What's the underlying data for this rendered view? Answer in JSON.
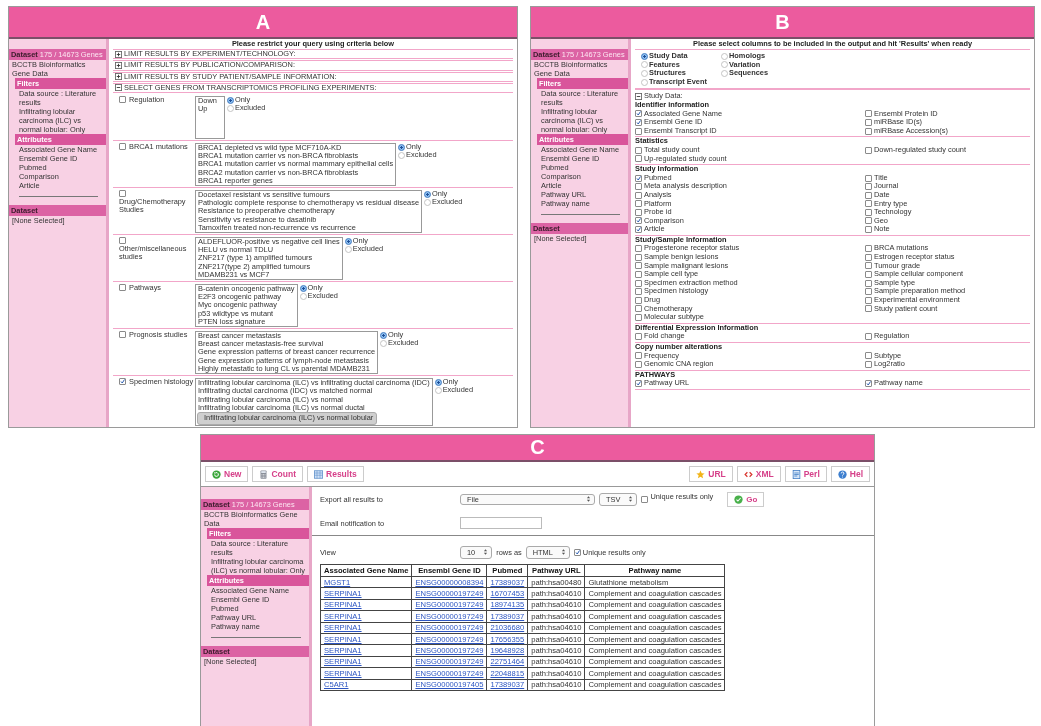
{
  "panel_a": {
    "label": "A",
    "sidebar": {
      "dataset": {
        "title": "Dataset",
        "count": "175 / 14673 Genes"
      },
      "database": "BCCTB Bioinformatics Gene Data",
      "filters": {
        "title": "Filters",
        "items": [
          "Data source : Literature results",
          "Infiltrating lobular carcinoma (ILC) vs normal lobular: Only"
        ]
      },
      "attributes": {
        "title": "Attributes",
        "items": [
          "Associated Gene Name",
          "Ensembl Gene ID",
          "Pubmed",
          "Comparison",
          "Article"
        ]
      },
      "dataset2": {
        "title": "Dataset",
        "value": "[None Selected]"
      }
    },
    "title": "Please restrict your query using criteria below",
    "sections": [
      {
        "title": "LIMIT RESULTS BY EXPERIMENT/TECHNOLOGY:",
        "expanded": false
      },
      {
        "title": "LIMIT RESULTS BY PUBLICATION/COMPARISON:",
        "expanded": false
      },
      {
        "title": "LIMIT RESULTS BY STUDY PATIENT/SAMPLE INFORMATION:",
        "expanded": false
      },
      {
        "title": "SELECT GENES FROM TRANSCRIPTOMICS PROFILING EXPERIMENTS:",
        "expanded": true
      }
    ],
    "filters": [
      {
        "label": "Regulation",
        "checked": false,
        "options": [
          {
            "text": "Down",
            "selected": false
          },
          {
            "text": "Up",
            "selected": false
          }
        ],
        "radios": [
          {
            "label": "Only",
            "selected": true
          },
          {
            "label": "Excluded",
            "selected": false
          }
        ]
      },
      {
        "label": "BRCA1 mutations",
        "checked": false,
        "options": [
          {
            "text": "BRCA1 depleted vs wild type MCF710A-KD",
            "selected": false
          },
          {
            "text": "BRCA1 mutation carrier vs non-BRCA fibroblasts",
            "selected": false
          },
          {
            "text": "BRCA1 mutation carrier vs normal mammary epithelial cells",
            "selected": false
          },
          {
            "text": "BRCA2 mutation carrier vs non-BRCA fibroblasts",
            "selected": false
          },
          {
            "text": "BRCA1 reporter genes",
            "selected": false
          }
        ],
        "radios": [
          {
            "label": "Only",
            "selected": true
          },
          {
            "label": "Excluded",
            "selected": false
          }
        ]
      },
      {
        "label": "Drug/Chemotherapy Studies",
        "checked": false,
        "options": [
          {
            "text": "Docetaxel resistant vs sensitive tumours",
            "selected": false
          },
          {
            "text": "Pathologic complete response to chemotherapy vs residual disease",
            "selected": false
          },
          {
            "text": "Resistance to preoperative chemotherapy",
            "selected": false
          },
          {
            "text": "Sensitivity vs resistance to dasatinib",
            "selected": false
          },
          {
            "text": "Tamoxifen treated non-recurrence vs recurrence",
            "selected": false
          }
        ],
        "radios": [
          {
            "label": "Only",
            "selected": true
          },
          {
            "label": "Excluded",
            "selected": false
          }
        ]
      },
      {
        "label": "Other/miscellaneous studies",
        "checked": false,
        "options": [
          {
            "text": "ALDEFLUOR-positive vs negative cell lines",
            "selected": false
          },
          {
            "text": "HELU vs normal TDLU",
            "selected": false
          },
          {
            "text": "ZNF217 (type 1) amplified tumours",
            "selected": false
          },
          {
            "text": "ZNF217(type 2) amplified tumours",
            "selected": false
          },
          {
            "text": "MDAMB231 vs MCF7",
            "selected": false
          }
        ],
        "radios": [
          {
            "label": "Only",
            "selected": true
          },
          {
            "label": "Excluded",
            "selected": false
          }
        ]
      },
      {
        "label": "Pathways",
        "checked": false,
        "options": [
          {
            "text": "B-catenin oncogenic pathway",
            "selected": false
          },
          {
            "text": "E2F3 oncogenic pathway",
            "selected": false
          },
          {
            "text": "Myc oncogenic pathway",
            "selected": false
          },
          {
            "text": "p53 wildtype vs mutant",
            "selected": false
          },
          {
            "text": "PTEN loss signature",
            "selected": false
          }
        ],
        "radios": [
          {
            "label": "Only",
            "selected": true
          },
          {
            "label": "Excluded",
            "selected": false
          }
        ]
      },
      {
        "label": "Prognosis studies",
        "checked": false,
        "options": [
          {
            "text": "Breast cancer metastasis",
            "selected": false
          },
          {
            "text": "Breast cancer metastasis-free survival",
            "selected": false
          },
          {
            "text": "Gene expression patterns of breast cancer recurrence",
            "selected": false
          },
          {
            "text": "Gene expression patterns of lymph-node metastasis",
            "selected": false
          },
          {
            "text": "Highly metastatic to lung CL vs parental MDAMB231",
            "selected": false
          }
        ],
        "radios": [
          {
            "label": "Only",
            "selected": true
          },
          {
            "label": "Excluded",
            "selected": false
          }
        ]
      },
      {
        "label": "Specimen histology",
        "checked": true,
        "options": [
          {
            "text": "Infiltrating lobular carcinoma (ILC) vs infiltrating ductal carcinoma (IDC)",
            "selected": false
          },
          {
            "text": "Infiltrating ductal carcinoma (IDC) vs matched normal",
            "selected": false
          },
          {
            "text": "Infiltrating lobular carcinoma (ILC) vs normal",
            "selected": false
          },
          {
            "text": "Infiltrating lobular carcinoma (ILC) vs normal ductal",
            "selected": false
          },
          {
            "text": "Infiltrating lobular carcinoma (ILC) vs normal lobular",
            "selected": true
          }
        ],
        "radios": [
          {
            "label": "Only",
            "selected": true
          },
          {
            "label": "Excluded",
            "selected": false
          }
        ]
      }
    ]
  },
  "panel_b": {
    "label": "B",
    "sidebar": {
      "dataset": {
        "title": "Dataset",
        "count": "175 / 14673 Genes"
      },
      "database": "BCCTB Bioinformatics Gene Data",
      "filters": {
        "title": "Filters",
        "items": [
          "Data source : Literature results",
          "Infiltrating lobular carcinoma (ILC) vs normal lobular: Only"
        ]
      },
      "attributes": {
        "title": "Attributes",
        "items": [
          "Associated Gene Name",
          "Ensembl Gene ID",
          "Pubmed",
          "Comparison",
          "Article",
          "Pathway URL",
          "Pathway name"
        ]
      },
      "dataset2": {
        "title": "Dataset",
        "value": "[None Selected]"
      }
    },
    "title": "Please select columns to be included in the output and hit 'Results' when ready",
    "pages": [
      {
        "label": "Study Data",
        "selected": true
      },
      {
        "label": "Homologs",
        "selected": false
      },
      {
        "label": "Features",
        "selected": false
      },
      {
        "label": "Variation",
        "selected": false
      },
      {
        "label": "Structures",
        "selected": false
      },
      {
        "label": "Sequences",
        "selected": false
      },
      {
        "label": "Transcript Event",
        "selected": false
      }
    ],
    "section": {
      "title": "Study Data:",
      "expanded": true
    },
    "groups": [
      {
        "title": "Identifier information",
        "left": [
          {
            "label": "Associated Gene Name",
            "checked": true
          },
          {
            "label": "Ensembl Gene ID",
            "checked": true
          },
          {
            "label": "Ensembl Transcript ID",
            "checked": false
          }
        ],
        "right": [
          {
            "label": "Ensembl Protein ID",
            "checked": false
          },
          {
            "label": "miRBase ID(s)",
            "checked": false
          },
          {
            "label": "miRBase Accession(s)",
            "checked": false
          }
        ]
      },
      {
        "title": "Statistics",
        "left": [
          {
            "label": "Total study count",
            "checked": false
          },
          {
            "label": "Up-regulated study count",
            "checked": false
          }
        ],
        "right": [
          {
            "label": "Down-regulated study count",
            "checked": false
          }
        ]
      },
      {
        "title": "Study Information",
        "left": [
          {
            "label": "Pubmed",
            "checked": true
          },
          {
            "label": "Meta analysis description",
            "checked": false
          },
          {
            "label": "Analysis",
            "checked": false
          },
          {
            "label": "Platform",
            "checked": false
          },
          {
            "label": "Probe id",
            "checked": false
          },
          {
            "label": "Comparison",
            "checked": true
          },
          {
            "label": "Article",
            "checked": true
          }
        ],
        "right": [
          {
            "label": "Title",
            "checked": false
          },
          {
            "label": "Journal",
            "checked": false
          },
          {
            "label": "Date",
            "checked": false
          },
          {
            "label": "Entry type",
            "checked": false
          },
          {
            "label": "Technology",
            "checked": false
          },
          {
            "label": "Geo",
            "checked": false
          },
          {
            "label": "Note",
            "checked": false
          }
        ]
      },
      {
        "title": "Study/Sample Information",
        "left": [
          {
            "label": "Progesterone receptor status",
            "checked": false
          },
          {
            "label": "Sample benign lesions",
            "checked": false
          },
          {
            "label": "Sample malignant lesions",
            "checked": false
          },
          {
            "label": "Sample cell type",
            "checked": false
          },
          {
            "label": "Specimen extraction method",
            "checked": false
          },
          {
            "label": "Specimen histology",
            "checked": false
          },
          {
            "label": "Drug",
            "checked": false
          },
          {
            "label": "Chemotherapy",
            "checked": false
          },
          {
            "label": "Molecular subtype",
            "checked": false
          }
        ],
        "right": [
          {
            "label": "BRCA mutations",
            "checked": false
          },
          {
            "label": "Estrogen receptor status",
            "checked": false
          },
          {
            "label": "Tumour grade",
            "checked": false
          },
          {
            "label": "Sample cellular component",
            "checked": false
          },
          {
            "label": "Sample type",
            "checked": false
          },
          {
            "label": "Sample preparation method",
            "checked": false
          },
          {
            "label": "Experimental environment",
            "checked": false
          },
          {
            "label": "Study patient count",
            "checked": false
          }
        ]
      },
      {
        "title": "Differential Expression Information",
        "left": [
          {
            "label": "Fold change",
            "checked": false
          }
        ],
        "right": [
          {
            "label": "Regulation",
            "checked": false
          }
        ]
      },
      {
        "title": "Copy number alterations",
        "left": [
          {
            "label": "Frequency",
            "checked": false
          },
          {
            "label": "Genomic CNA region",
            "checked": false
          }
        ],
        "right": [
          {
            "label": "Subtype",
            "checked": false
          },
          {
            "label": "Log2ratio",
            "checked": false
          }
        ]
      },
      {
        "title": "PATHWAYS",
        "left": [
          {
            "label": "Pathway URL",
            "checked": true
          }
        ],
        "right": [
          {
            "label": "Pathway name",
            "checked": true
          }
        ]
      }
    ]
  },
  "panel_c": {
    "label": "C",
    "toolbar_left": [
      "New",
      "Count",
      "Results"
    ],
    "toolbar_right": [
      "URL",
      "XML",
      "Perl",
      "Hel"
    ],
    "sidebar": {
      "dataset": {
        "title": "Dataset",
        "count": "175 / 14673 Genes"
      },
      "database": "BCCTB Bioinformatics Gene Data",
      "filters": {
        "title": "Filters",
        "items": [
          "Data source : Literature results",
          "Infiltrating lobular carcinoma (ILC) vs normal lobular: Only"
        ]
      },
      "attributes": {
        "title": "Attributes",
        "items": [
          "Associated Gene Name",
          "Ensembl Gene ID",
          "Pubmed",
          "Pathway URL",
          "Pathway name"
        ]
      },
      "dataset2": {
        "title": "Dataset",
        "value": "[None Selected]"
      }
    },
    "export": {
      "label": "Export  all results to",
      "destination": "File",
      "format": "TSV",
      "unique_label": "Unique results only",
      "unique_checked": false,
      "go": "Go"
    },
    "email": {
      "label": "Email notification to"
    },
    "view": {
      "label": "View",
      "rows": "10",
      "rows_as": "rows as",
      "format": "HTML",
      "unique_label": "Unique results only",
      "unique_checked": true
    },
    "table": {
      "columns": [
        {
          "label": "Associated Gene Name",
          "kind": "link"
        },
        {
          "label": "Ensembl Gene ID",
          "kind": "link"
        },
        {
          "label": "Pubmed",
          "kind": "link"
        },
        {
          "label": "Pathway URL",
          "kind": "text"
        },
        {
          "label": "Pathway name",
          "kind": "text"
        }
      ],
      "rows": [
        [
          "MGST1",
          "ENSG00000008394",
          "17389037",
          "path:hsa00480",
          "Glutathione metabolism"
        ],
        [
          "SERPINA1",
          "ENSG00000197249",
          "16707453",
          "path:hsa04610",
          "Complement and coagulation cascades"
        ],
        [
          "SERPINA1",
          "ENSG00000197249",
          "18974135",
          "path:hsa04610",
          "Complement and coagulation cascades"
        ],
        [
          "SERPINA1",
          "ENSG00000197249",
          "17389037",
          "path:hsa04610",
          "Complement and coagulation cascades"
        ],
        [
          "SERPINA1",
          "ENSG00000197249",
          "21036680",
          "path:hsa04610",
          "Complement and coagulation cascades"
        ],
        [
          "SERPINA1",
          "ENSG00000197249",
          "17656355",
          "path:hsa04610",
          "Complement and coagulation cascades"
        ],
        [
          "SERPINA1",
          "ENSG00000197249",
          "19648928",
          "path:hsa04610",
          "Complement and coagulation cascades"
        ],
        [
          "SERPINA1",
          "ENSG00000197249",
          "22751464",
          "path:hsa04610",
          "Complement and coagulation cascades"
        ],
        [
          "SERPINA1",
          "ENSG00000197249",
          "22048815",
          "path:hsa04610",
          "Complement and coagulation cascades"
        ],
        [
          "C5AR1",
          "ENSG00000197405",
          "17389037",
          "path:hsa04610",
          "Complement and coagulation cascades"
        ]
      ]
    }
  }
}
